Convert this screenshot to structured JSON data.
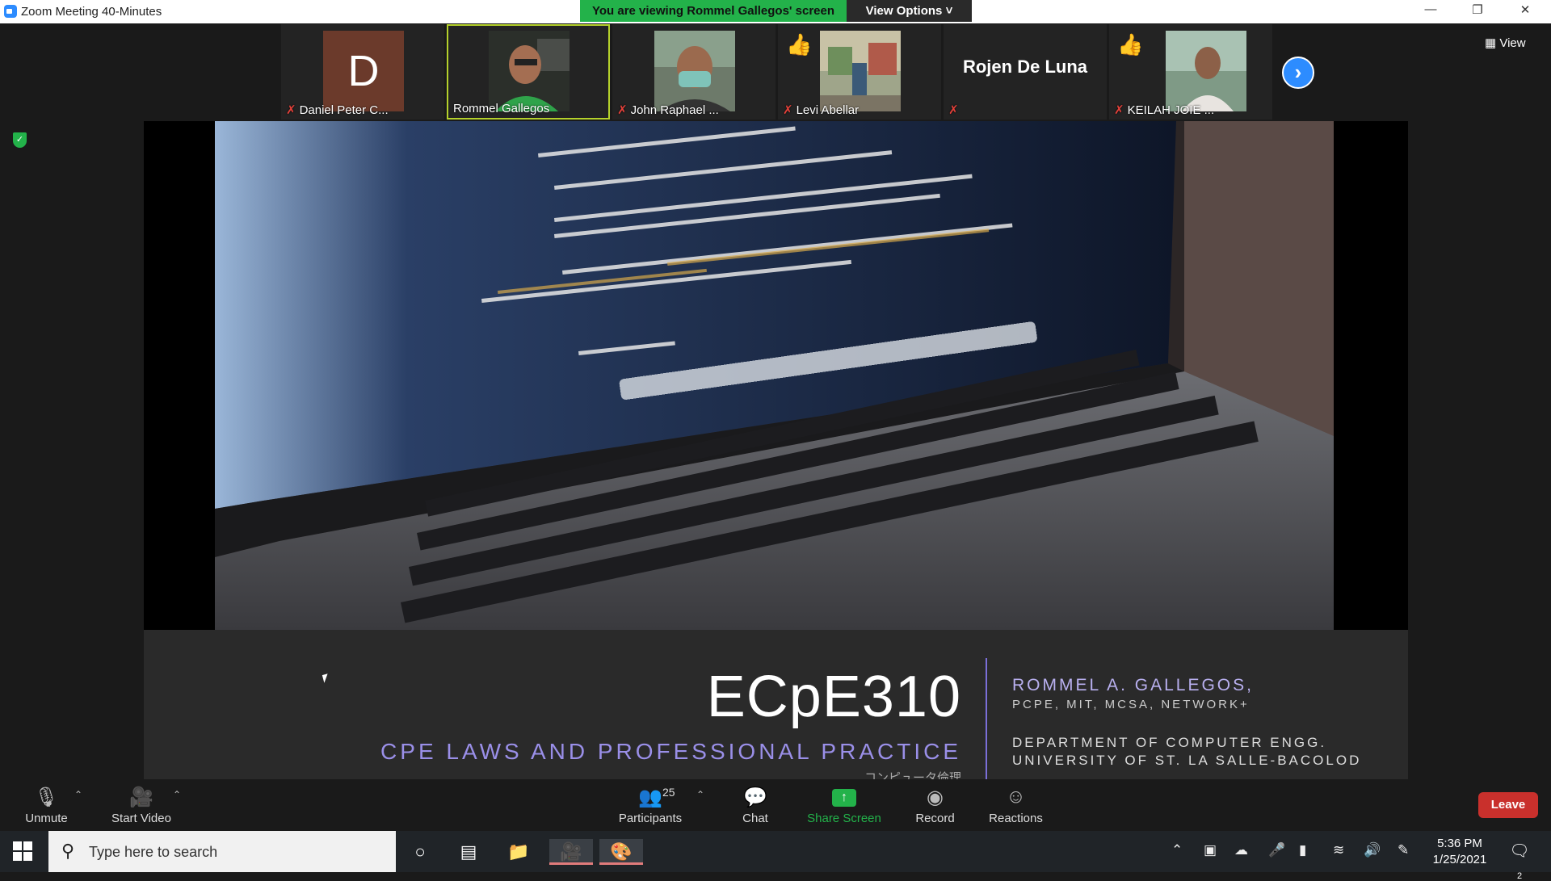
{
  "window": {
    "title": "Zoom Meeting 40-Minutes"
  },
  "share_banner": {
    "viewing": "You are viewing Rommel Gallegos' screen",
    "view_options": "View Options ˅"
  },
  "participants_strip": [
    {
      "name": "Daniel Peter C...",
      "avatar_letter": "D",
      "muted": true
    },
    {
      "name": "Rommel Gallegos",
      "muted": false
    },
    {
      "name": "John Raphael ...",
      "muted": true
    },
    {
      "name": "Levi Abellar",
      "muted": true
    },
    {
      "name": "Rojen De Luna",
      "muted": true
    },
    {
      "name": "KEILAH JOIE ...",
      "muted": true
    }
  ],
  "view_button": "View",
  "slide": {
    "course_code": "ECpE310",
    "course_title": "CPE LAWS AND PROFESSIONAL PRACTICE",
    "course_sub": "コンピュータ倫理",
    "prof_name": "ROMMEL A. GALLEGOS,",
    "prof_creds": "PCPE, MIT, MCSA, NETWORK+",
    "dept1": "DEPARTMENT OF COMPUTER ENGG.",
    "dept2": "UNIVERSITY OF ST. LA SALLE-BACOLOD"
  },
  "toolbar": {
    "unmute": "Unmute",
    "start_video": "Start Video",
    "participants": "Participants",
    "participants_count": "25",
    "chat": "Chat",
    "share_screen": "Share Screen",
    "record": "Record",
    "reactions": "Reactions",
    "leave": "Leave"
  },
  "taskbar": {
    "search_placeholder": "Type here to search",
    "time": "5:36 PM",
    "date": "1/25/2021",
    "notification_count": "2"
  },
  "colors": {
    "accent_green": "#23b24a",
    "zoom_blue": "#2d8cff",
    "leave_red": "#c9302c",
    "slide_purple": "#9a8fe8"
  }
}
